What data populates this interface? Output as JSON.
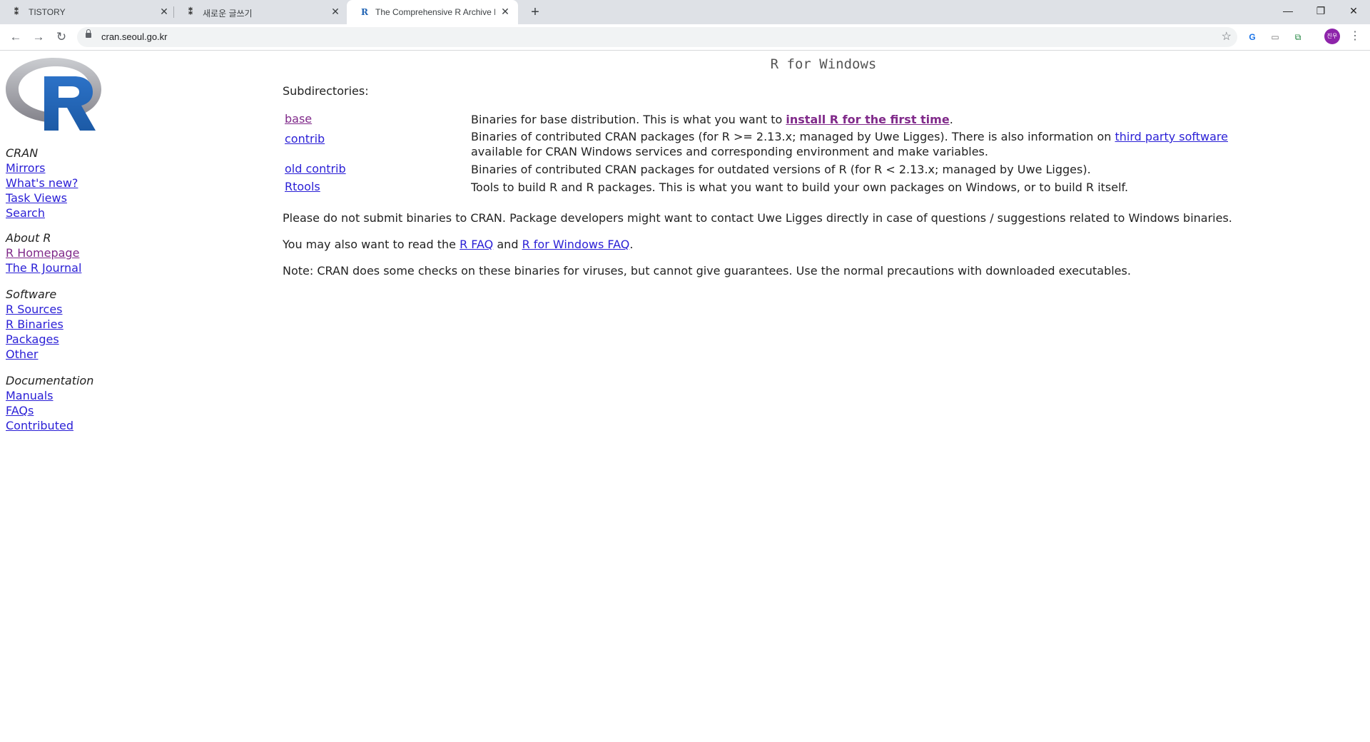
{
  "browser": {
    "tabs": [
      {
        "title": "TISTORY",
        "favicon": "tistory-icon",
        "active": false
      },
      {
        "title": "새로운 글쓰기",
        "favicon": "tistory-icon",
        "active": false
      },
      {
        "title": "The Comprehensive R Archive N",
        "favicon": "r-logo-icon",
        "active": true
      }
    ],
    "url": "cran.seoul.go.kr",
    "avatar_text": "진우",
    "colors": {
      "tabbar": "#dee1e6",
      "avatar": "#8e24aa",
      "link": "#2a1fd6",
      "visited_link": "#802a8a",
      "r_blue": "#2466b5"
    }
  },
  "sidebar": {
    "sections": [
      {
        "heading": "CRAN",
        "links": [
          {
            "label": "Mirrors"
          },
          {
            "label": "What's new?"
          },
          {
            "label": "Task Views"
          },
          {
            "label": "Search"
          }
        ]
      },
      {
        "heading": "About R",
        "links": [
          {
            "label": "R Homepage",
            "visited": true
          },
          {
            "label": "The R Journal"
          }
        ]
      },
      {
        "heading": "Software",
        "links": [
          {
            "label": "R Sources"
          },
          {
            "label": "R Binaries"
          },
          {
            "label": "Packages"
          },
          {
            "label": "Other"
          }
        ]
      },
      {
        "heading": "Documentation",
        "links": [
          {
            "label": "Manuals"
          },
          {
            "label": "FAQs"
          },
          {
            "label": "Contributed"
          }
        ]
      }
    ]
  },
  "main": {
    "title": "R for Windows",
    "subdirectories_label": "Subdirectories:",
    "rows": [
      {
        "name": "base",
        "visited": true,
        "desc_before": "Binaries for base distribution. This is what you want to ",
        "desc_link": "install R for the first time",
        "desc_after": "."
      },
      {
        "name": "contrib",
        "visited": false,
        "desc_before": "Binaries of contributed CRAN packages (for R >= 2.13.x; managed by Uwe Ligges). There is also information on ",
        "desc_link": "third party software",
        "desc_after": " available for CRAN Windows services and corresponding environment and make variables."
      },
      {
        "name": "old contrib",
        "visited": false,
        "desc_before": "Binaries of contributed CRAN packages for outdated versions of R (for R < 2.13.x; managed by Uwe Ligges).",
        "desc_link": "",
        "desc_after": ""
      },
      {
        "name": "Rtools",
        "visited": false,
        "desc_before": "Tools to build R and R packages. This is what you want to build your own packages on Windows, or to build R itself.",
        "desc_link": "",
        "desc_after": ""
      }
    ],
    "para1": "Please do not submit binaries to CRAN. Package developers might want to contact Uwe Ligges directly in case of questions / suggestions related to Windows binaries.",
    "para2": {
      "before": "You may also want to read the ",
      "link1": "R FAQ",
      "middle": " and ",
      "link2": "R for Windows FAQ",
      "after": "."
    },
    "para3": "Note: CRAN does some checks on these binaries for viruses, but cannot give guarantees. Use the normal precautions with downloaded executables."
  }
}
